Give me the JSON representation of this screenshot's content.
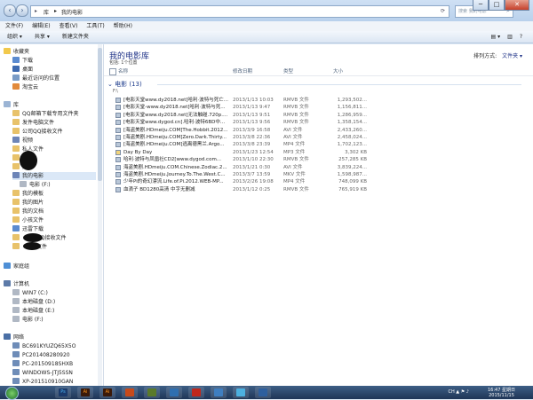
{
  "window": {
    "breadcrumb": [
      "库",
      "我的电影"
    ],
    "search_placeholder": "搜索 我的电影",
    "controls": [
      "─",
      "□",
      "✕"
    ]
  },
  "menu": [
    "文件(F)",
    "编辑(E)",
    "查看(V)",
    "工具(T)",
    "帮助(H)"
  ],
  "toolbar": {
    "organize": "组织 ▾",
    "share": "共享 ▾",
    "new_folder": "新建文件夹"
  },
  "sidebar": {
    "favorites": "收藏夹",
    "fav_items": [
      "下载",
      "桌面",
      "最近访问的位置",
      "淘宝云"
    ],
    "libraries": "库",
    "lib_items": [
      "QQ邮箱下载专用文件夹",
      "发件电脑文件",
      "公司QQ接收文件",
      "视频",
      "私人文件",
      "文件",
      "文件",
      "我的电影",
      "电影 (F:)",
      "我的模板",
      "我的图片",
      "我的文档",
      "小孩文件",
      "迅雷下载",
      "QQ接收文件",
      "文件"
    ],
    "homegroup": "家庭组",
    "computer": "计算机",
    "computer_items": [
      "WIN7 (C:)",
      "本地磁盘 (D:)",
      "本地磁盘 (E:)",
      "电影 (F:)"
    ],
    "network": "网络",
    "network_items": [
      "BC691KYUZQ65X5O",
      "PC201408280920",
      "PC-20150918SHXB",
      "WINDOWS-JTJ5SSN",
      "XP-201510910GAN"
    ]
  },
  "library": {
    "title": "我的电影库",
    "subtitle": "包括: 1个位置",
    "arrange_label": "排列方式:",
    "arrange_value": "文件夹 ▾",
    "columns": {
      "name": "名称",
      "date": "修改日期",
      "type": "类型",
      "size": "大小"
    },
    "group": "电影 (13)",
    "group_path": "F:\\",
    "files": [
      {
        "name": "[电影天堂www.dy2018.net]哈利·波特与死亡...",
        "date": "2013/1/13 10:03",
        "type": "RMVB 文件",
        "size": "1,293,502..."
      },
      {
        "name": "[电影天堂-www.dy2018.net]哈利·波特与死...",
        "date": "2013/1/13 9:47",
        "type": "RMVB 文件",
        "size": "1,156,811..."
      },
      {
        "name": "[电影天堂www.dy2018.net]无法触碰.720p....",
        "date": "2013/1/13 9:51",
        "type": "RMVB 文件",
        "size": "1,286,959..."
      },
      {
        "name": "[电影天堂www.dygod.cn].哈利·波特6BD中...",
        "date": "2013/1/13 9:56",
        "type": "RMVB 文件",
        "size": "1,358,154..."
      },
      {
        "name": "[海盗美剧.HDmeiju.COM]The.Hobbit.2012...",
        "date": "2013/3/9 16:58",
        "type": "AVI 文件",
        "size": "2,433,260..."
      },
      {
        "name": "[海盗美剧.HDmeiju.COM]Zero.Dark.Thirty...",
        "date": "2013/3/8 22:36",
        "type": "AVI 文件",
        "size": "2,458,024..."
      },
      {
        "name": "[海盗美剧.HDmeiju.COM]逃离德黑兰.Argo...",
        "date": "2013/3/8 23:39",
        "type": "MP4 文件",
        "size": "1,702,123..."
      },
      {
        "name": "Day By Day",
        "date": "2013/1/23 12:54",
        "type": "MP3 文件",
        "size": "3,302 KB"
      },
      {
        "name": "哈利·波特与凤凰社CD2[www.dygod.com...",
        "date": "2013/1/10 22:30",
        "type": "RMVB 文件",
        "size": "257,285 KB"
      },
      {
        "name": "海盗美剧.HDmeiju.COM.Chinese.Zodiac.2...",
        "date": "2013/1/21 0:30",
        "type": "AVI 文件",
        "size": "3,839,224..."
      },
      {
        "name": "海盗美剧.HDmeiju.Journey.To.The.West.C...",
        "date": "2013/3/7 13:59",
        "type": "MKV 文件",
        "size": "1,598,987..."
      },
      {
        "name": "少年Pi的奇幻漂流.Life.of.Pi.2012.WEB-MP...",
        "date": "2013/2/26 19:08",
        "type": "MP4 文件",
        "size": "748,099 KB"
      },
      {
        "name": "血滴子 BD1280高清 中字无删减",
        "date": "2013/1/12 0:25",
        "type": "RMVB 文件",
        "size": "765,919 KB"
      }
    ]
  },
  "taskbar": {
    "apps": [
      "Ps",
      "Ai",
      "Ai",
      "",
      "",
      "",
      "",
      "",
      "",
      ""
    ],
    "tray_icons": "CH ▲ ⚑ ♪",
    "time": "16:47 星期日",
    "date": "2015/11/15"
  },
  "colors": {
    "accent": "#1e3287",
    "taskbar": "#1f3556"
  }
}
